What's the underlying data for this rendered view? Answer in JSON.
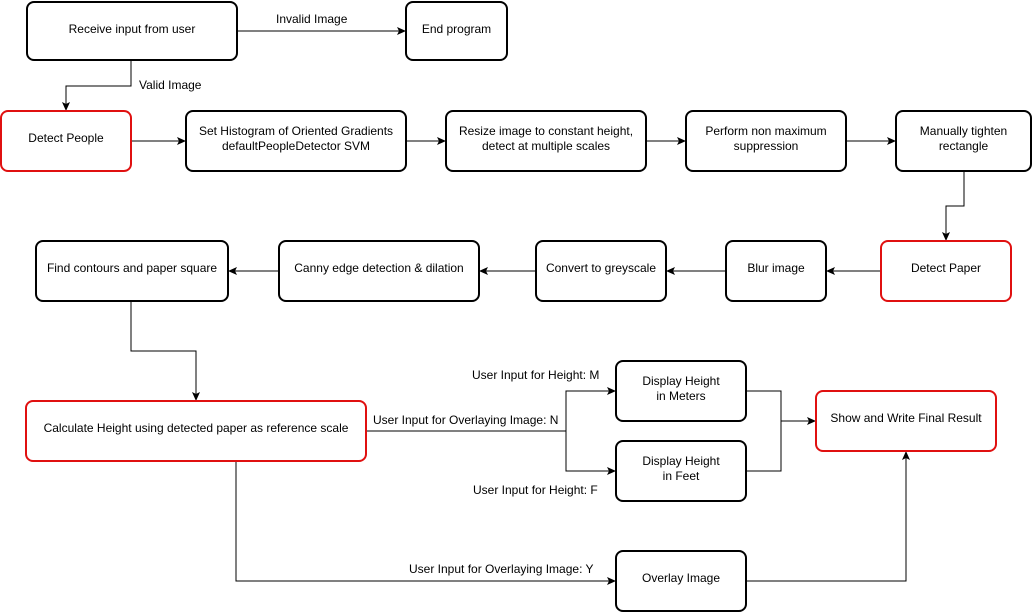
{
  "colors": {
    "highlight": "#e01010",
    "default": "#000000"
  },
  "nodes": {
    "receive": {
      "lines": [
        "Receive input from user"
      ],
      "highlight": false
    },
    "end": {
      "lines": [
        "End program"
      ],
      "highlight": false
    },
    "detect_people": {
      "lines": [
        "Detect People"
      ],
      "highlight": true
    },
    "hog": {
      "lines": [
        "Set Histogram of Oriented Gradients",
        "defaultPeopleDetector SVM"
      ],
      "highlight": false
    },
    "resize": {
      "lines": [
        "Resize image to constant height,",
        "detect at multiple scales"
      ],
      "highlight": false
    },
    "nms": {
      "lines": [
        "Perform non maximum",
        "suppression"
      ],
      "highlight": false
    },
    "tighten": {
      "lines": [
        "Manually tighten",
        "rectangle"
      ],
      "highlight": false
    },
    "detect_paper": {
      "lines": [
        "Detect Paper"
      ],
      "highlight": true
    },
    "blur": {
      "lines": [
        "Blur image"
      ],
      "highlight": false
    },
    "grey": {
      "lines": [
        "Convert to greyscale"
      ],
      "highlight": false
    },
    "canny": {
      "lines": [
        "Canny edge detection & dilation"
      ],
      "highlight": false
    },
    "contours": {
      "lines": [
        "Find contours and paper square"
      ],
      "highlight": false
    },
    "calc": {
      "lines": [
        "Calculate Height using detected paper as reference scale"
      ],
      "highlight": true
    },
    "meters": {
      "lines": [
        "Display Height",
        "in Meters"
      ],
      "highlight": false
    },
    "feet": {
      "lines": [
        "Display Height",
        "in Feet"
      ],
      "highlight": false
    },
    "final": {
      "lines": [
        "Show and Write Final Result"
      ],
      "highlight": true
    },
    "overlay": {
      "lines": [
        "Overlay Image"
      ],
      "highlight": false
    }
  },
  "edge_labels": {
    "invalid": "Invalid Image",
    "valid": "Valid Image",
    "overlay_n": "User Input for Overlaying Image: N",
    "height_m": "User Input for Height: M",
    "height_f": "User Input for Height: F",
    "overlay_y": "User Input for Overlaying Image: Y"
  }
}
